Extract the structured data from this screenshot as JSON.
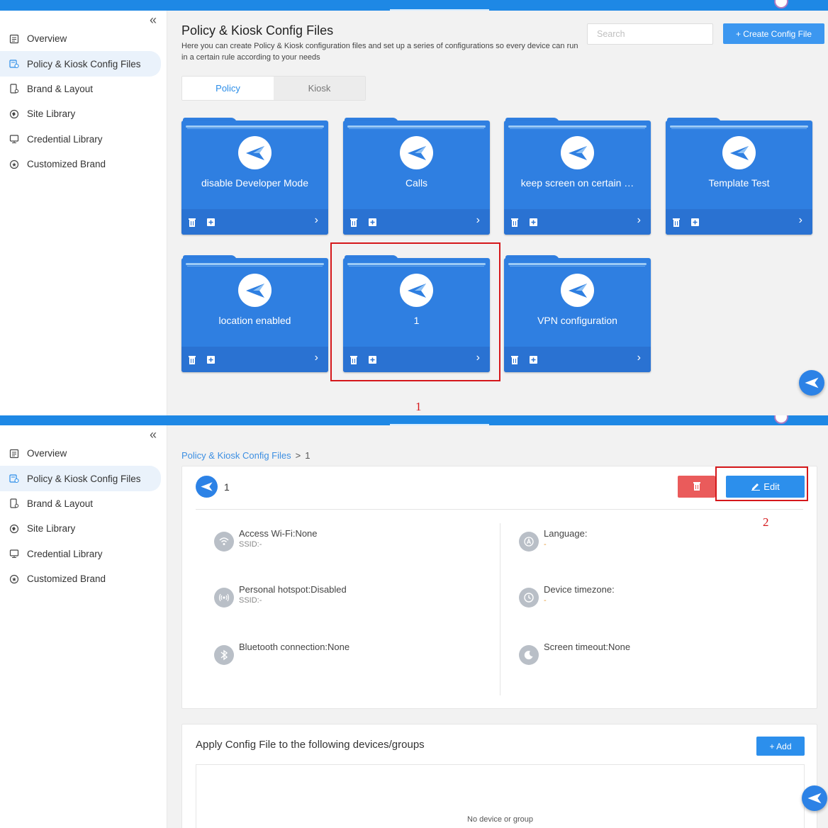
{
  "sidebar": {
    "items": [
      {
        "label": "Overview",
        "icon": "overview-icon"
      },
      {
        "label": "Policy & Kiosk Config Files",
        "icon": "config-files-icon"
      },
      {
        "label": "Brand & Layout",
        "icon": "brand-layout-icon"
      },
      {
        "label": "Site Library",
        "icon": "site-library-icon"
      },
      {
        "label": "Credential Library",
        "icon": "credential-library-icon"
      },
      {
        "label": "Customized Brand",
        "icon": "customized-brand-icon"
      }
    ],
    "active_index": 1
  },
  "list_page": {
    "title": "Policy & Kiosk Config Files",
    "description": "Here you can create Policy & Kiosk configuration files and set up a series of configurations so every device can run in a certain rule according to your needs",
    "search_placeholder": "Search",
    "create_label": "+ Create Config File",
    "tabs": [
      "Policy",
      "Kiosk"
    ],
    "active_tab": "Policy",
    "folders": [
      {
        "name": "disable Developer Mode"
      },
      {
        "name": "Calls"
      },
      {
        "name": "keep screen on certain …"
      },
      {
        "name": "Template Test"
      },
      {
        "name": "location enabled"
      },
      {
        "name": "1"
      },
      {
        "name": "VPN configuration"
      }
    ]
  },
  "annotations": {
    "step1": "1",
    "step2": "2"
  },
  "detail_page": {
    "breadcrumb": {
      "parent": "Policy & Kiosk Config Files",
      "separator": ">",
      "current": "1"
    },
    "name": "1",
    "edit_label": "Edit",
    "settings_left": [
      {
        "label": "Access Wi-Fi:None",
        "sub": "SSID:-",
        "icon": "wifi-icon"
      },
      {
        "label": "Personal hotspot:Disabled",
        "sub": "SSID:-",
        "icon": "hotspot-icon"
      },
      {
        "label": "Bluetooth connection:None",
        "sub": "",
        "icon": "bluetooth-icon"
      }
    ],
    "settings_right": [
      {
        "label": "Language:",
        "sub": "-",
        "icon": "language-icon"
      },
      {
        "label": "Device timezone:",
        "sub": "-",
        "icon": "clock-icon"
      },
      {
        "label": "Screen timeout:None",
        "sub": "",
        "icon": "screen-timeout-icon"
      }
    ],
    "apply_title": "Apply Config File to the following devices/groups",
    "add_label": "+ Add",
    "empty_text": "No device or group"
  },
  "colors": {
    "primary": "#2c8fec",
    "folder": "#2f7fe1",
    "danger": "#ea5b5b",
    "annotation": "#d5181b"
  }
}
